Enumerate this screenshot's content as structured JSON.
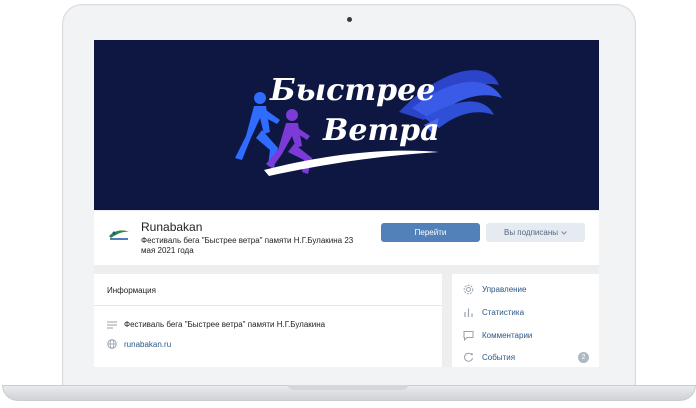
{
  "cover": {
    "title_line1": "Быстрее",
    "title_line2": "Ветра"
  },
  "group": {
    "name": "Runabakan",
    "status": "Фестиваль бега \"Быстрее ветра\" памяти Н.Г.Булакина 23 мая 2021 года",
    "go_button": "Перейти",
    "subscribed_button": "Вы подписаны"
  },
  "info": {
    "title": "Информация",
    "description": "Фестиваль бега \"Быстрее ветра\" памяти Н.Г.Булакина",
    "website": "runabakan.ru"
  },
  "menu": {
    "items": [
      {
        "label": "Управление",
        "icon": "gear-icon"
      },
      {
        "label": "Статистика",
        "icon": "stats-icon"
      },
      {
        "label": "Комментарии",
        "icon": "comment-icon"
      },
      {
        "label": "События",
        "icon": "event-icon",
        "badge": "2"
      }
    ]
  },
  "colors": {
    "cover_bg": "#0e1741",
    "accent": "#5181b8",
    "link": "#2a5885"
  }
}
